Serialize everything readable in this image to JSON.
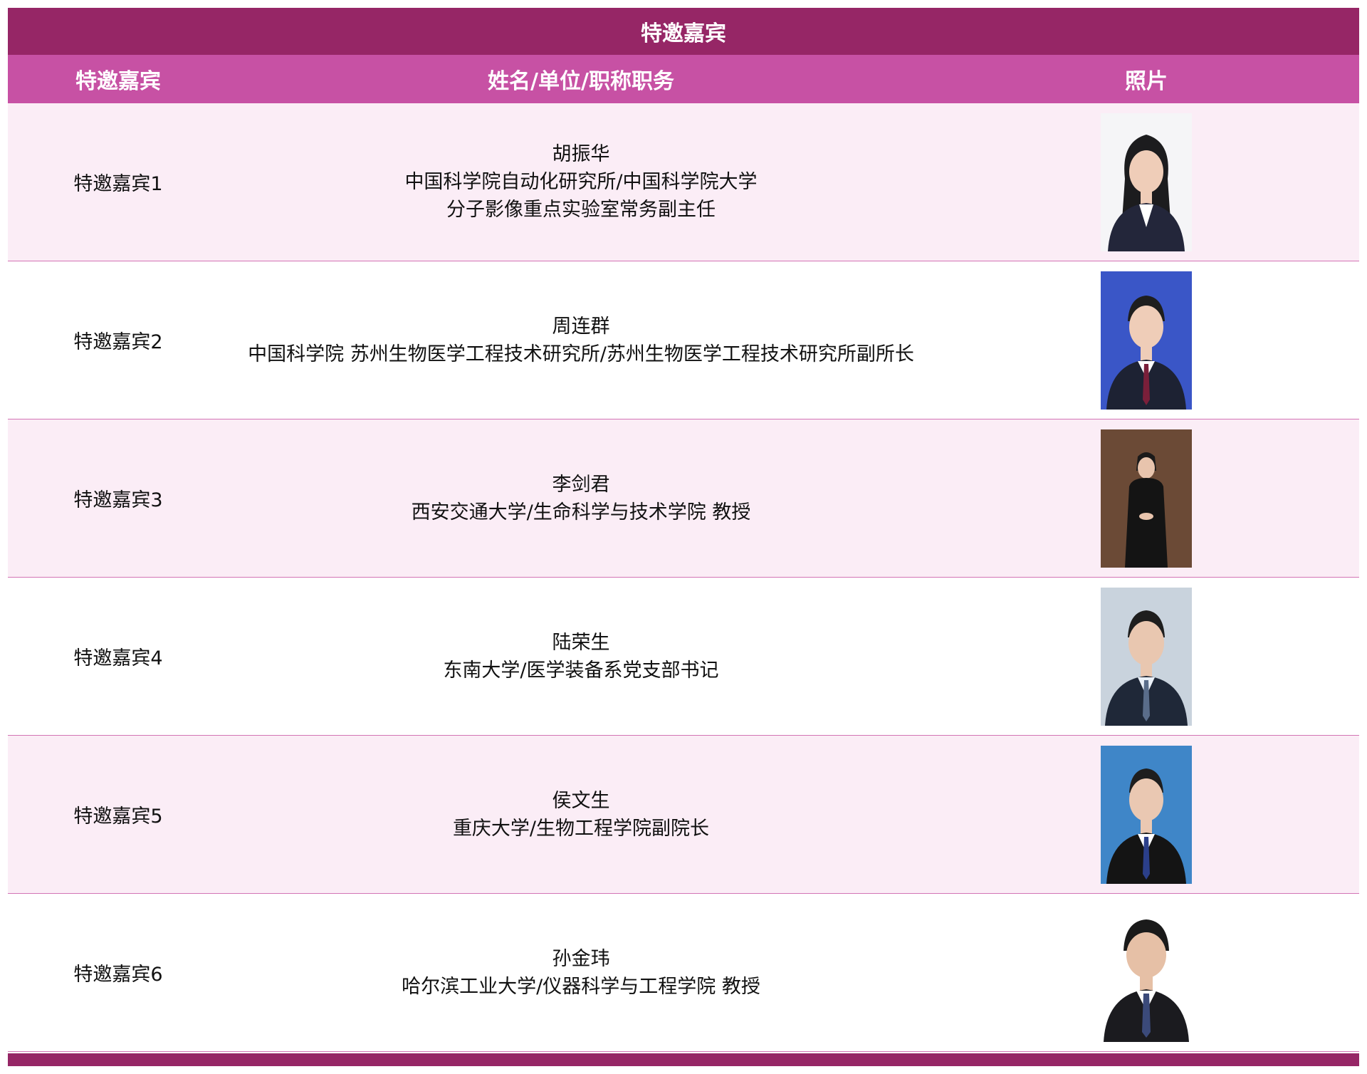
{
  "title": "特邀嘉宾",
  "headers": {
    "col1": "特邀嘉宾",
    "col2": "姓名/单位/职称职务",
    "col3": "照片"
  },
  "colors": {
    "title_bar": "#962666",
    "header_row": "#c751a4",
    "row_alt": "#fbedf6",
    "divider": "#d374b5"
  },
  "guests": [
    {
      "label": "特邀嘉宾1",
      "name": "胡振华",
      "line1": "中国科学院自动化研究所/中国科学院大学",
      "line2": "分子影像重点实验室常务副主任",
      "photo": "portrait-photo"
    },
    {
      "label": "特邀嘉宾2",
      "name": "周连群",
      "line1": "中国科学院 苏州生物医学工程技术研究所/苏州生物医学工程技术研究所副所长",
      "line2": "",
      "photo": "portrait-photo"
    },
    {
      "label": "特邀嘉宾3",
      "name": "李剑君",
      "line1": "西安交通大学/生命科学与技术学院 教授",
      "line2": "",
      "photo": "portrait-photo"
    },
    {
      "label": "特邀嘉宾4",
      "name": "陆荣生",
      "line1": "东南大学/医学装备系党支部书记",
      "line2": "",
      "photo": "portrait-photo"
    },
    {
      "label": "特邀嘉宾5",
      "name": "侯文生",
      "line1": "重庆大学/生物工程学院副院长",
      "line2": "",
      "photo": "portrait-photo"
    },
    {
      "label": "特邀嘉宾6",
      "name": "孙金玮",
      "line1": "哈尔滨工业大学/仪器科学与工程学院 教授",
      "line2": "",
      "photo": "portrait-photo"
    }
  ]
}
